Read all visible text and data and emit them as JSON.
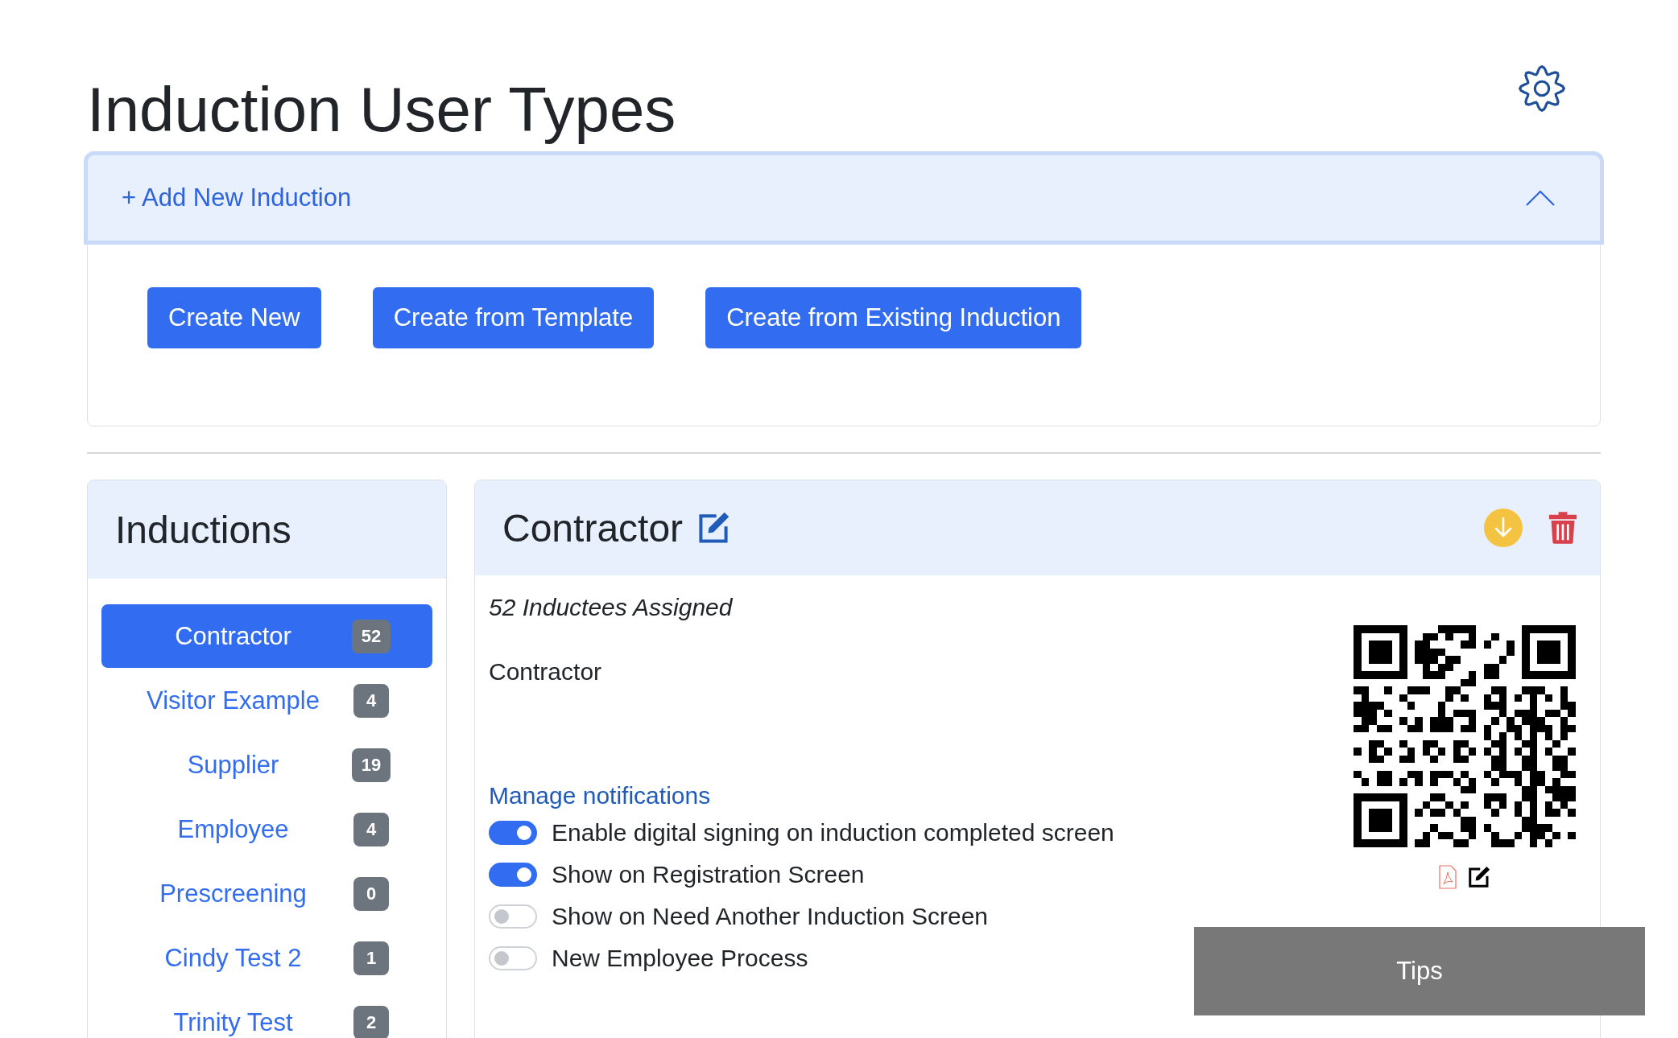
{
  "page": {
    "title": "Induction User Types"
  },
  "add_panel": {
    "header": "+ Add New Induction",
    "expanded": true,
    "buttons": [
      "Create New",
      "Create from Template",
      "Create from Existing Induction"
    ]
  },
  "inductions": {
    "title": "Inductions",
    "items": [
      {
        "label": "Contractor",
        "count": "52",
        "selected": true
      },
      {
        "label": "Visitor Example",
        "count": "4",
        "selected": false
      },
      {
        "label": "Supplier",
        "count": "19",
        "selected": false
      },
      {
        "label": "Employee",
        "count": "4",
        "selected": false
      },
      {
        "label": "Prescreening",
        "count": "0",
        "selected": false
      },
      {
        "label": "Cindy Test 2",
        "count": "1",
        "selected": false
      },
      {
        "label": "Trinity Test",
        "count": "2",
        "selected": false
      }
    ]
  },
  "detail": {
    "title": "Contractor",
    "assigned": "52 Inductees Assigned",
    "description": "Contractor",
    "manage_link": "Manage notifications",
    "toggles": [
      {
        "label": "Enable digital signing on induction completed screen",
        "on": true
      },
      {
        "label": "Show on Registration Screen",
        "on": true
      },
      {
        "label": "Show on Need Another Induction Screen",
        "on": false
      },
      {
        "label": "New Employee Process",
        "on": false
      }
    ]
  },
  "tips": {
    "label": "Tips"
  }
}
